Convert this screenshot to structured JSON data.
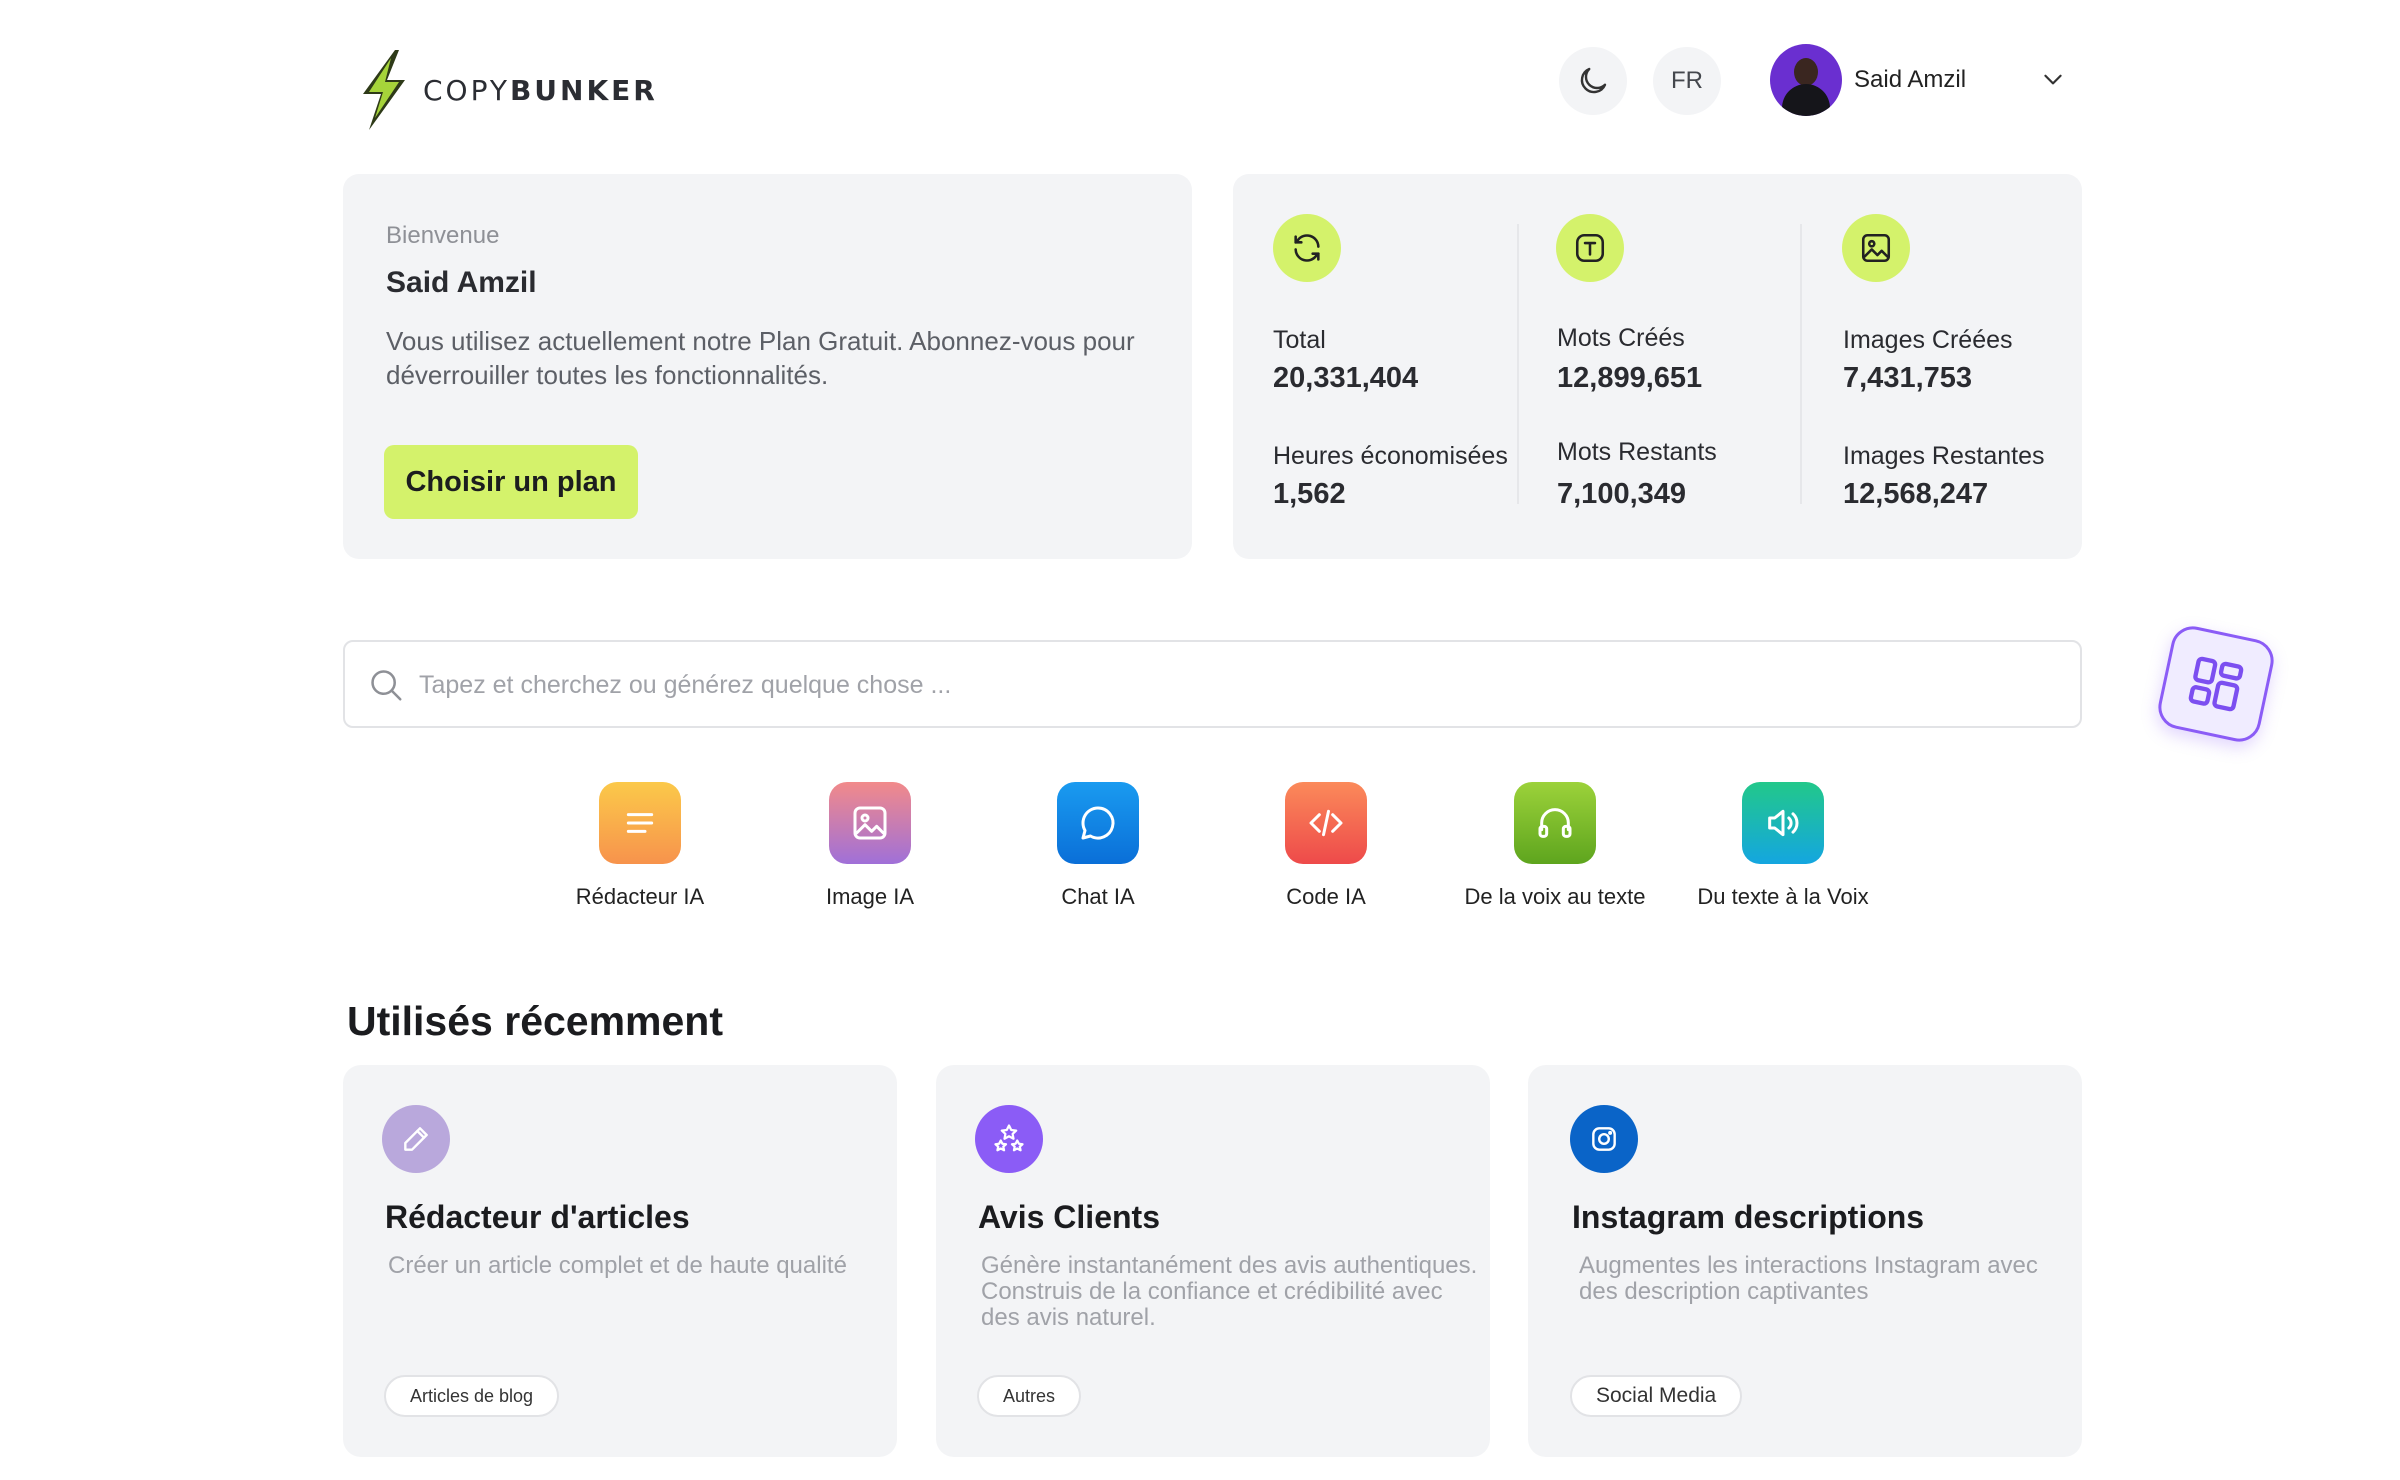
{
  "header": {
    "logo_text_light": "COPY",
    "logo_text_bold": "BUNKER",
    "lang": "FR",
    "user_name": "Said Amzil"
  },
  "welcome": {
    "greeting": "Bienvenue",
    "name": "Said Amzil",
    "description": "Vous utilisez actuellement notre Plan Gratuit. Abonnez-vous pour déverrouiller toutes les fonctionnalités.",
    "cta": "Choisir un plan"
  },
  "stats": {
    "total_label": "Total",
    "total_value": "20,331,404",
    "hours_label": "Heures économisées",
    "hours_value": "1,562",
    "words_created_label": "Mots Créés",
    "words_created_value": "12,899,651",
    "words_left_label": "Mots Restants",
    "words_left_value": "7,100,349",
    "images_created_label": "Images Créées",
    "images_created_value": "7,431,753",
    "images_left_label": "Images Restantes",
    "images_left_value": "12,568,247"
  },
  "search": {
    "placeholder": "Tapez et cherchez ou générez quelque chose ..."
  },
  "tools": [
    {
      "label": "Rédacteur IA",
      "icon": "text-lines-icon"
    },
    {
      "label": "Image IA",
      "icon": "image-icon"
    },
    {
      "label": "Chat IA",
      "icon": "chat-bubble-icon"
    },
    {
      "label": "Code IA",
      "icon": "code-icon"
    },
    {
      "label": "De la voix au texte",
      "icon": "headphones-icon"
    },
    {
      "label": "Du texte à la Voix",
      "icon": "speaker-icon"
    }
  ],
  "recent": {
    "title": "Utilisés récemment",
    "cards": [
      {
        "title": "Rédacteur d'articles",
        "description": "Créer un article complet et de haute qualité",
        "tag": "Articles de blog",
        "icon": "pencil-icon"
      },
      {
        "title": "Avis Clients",
        "description": "Génère instantanément des avis authentiques. Construis de la confiance et crédibilité avec des avis naturel.",
        "tag": "Autres",
        "icon": "stars-icon"
      },
      {
        "title": "Instagram descriptions",
        "description": "Augmentes les interactions Instagram avec des description captivantes",
        "tag": "Social Media",
        "icon": "instagram-icon"
      }
    ]
  },
  "colors": {
    "accent_lime": "#d4f26b",
    "card_bg": "#f3f4f6",
    "purple": "#8b5cf6"
  }
}
